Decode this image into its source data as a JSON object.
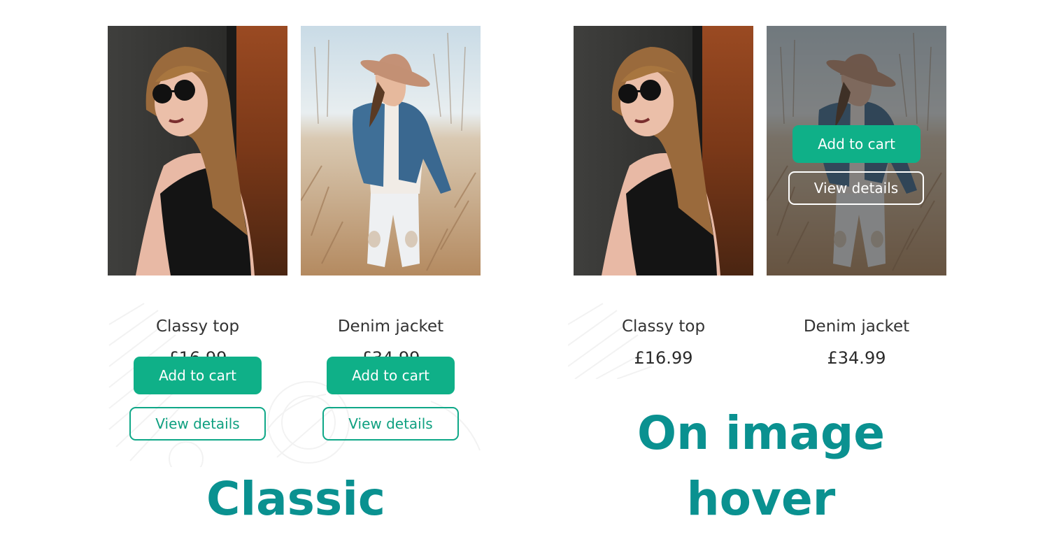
{
  "classic": {
    "caption": "Classic",
    "products": [
      {
        "name": "Classy top",
        "price": "£16.99",
        "add_to_cart": "Add to cart",
        "view_details": "View details"
      },
      {
        "name": "Denim jacket",
        "price": "£34.99",
        "add_to_cart": "Add to cart",
        "view_details": "View details"
      }
    ]
  },
  "hover": {
    "caption_line1": "On image",
    "caption_line2": "hover",
    "products": [
      {
        "name": "Classy top",
        "price": "£16.99"
      },
      {
        "name": "Denim jacket",
        "price": "£34.99",
        "add_to_cart": "Add to cart",
        "view_details": "View details"
      }
    ]
  },
  "colors": {
    "accent": "#0fb088",
    "caption": "#0a9190",
    "text": "#333333"
  },
  "icons": {
    "product_image_1": "woman-sunglasses-photo",
    "product_image_2": "woman-hat-denim-photo"
  }
}
